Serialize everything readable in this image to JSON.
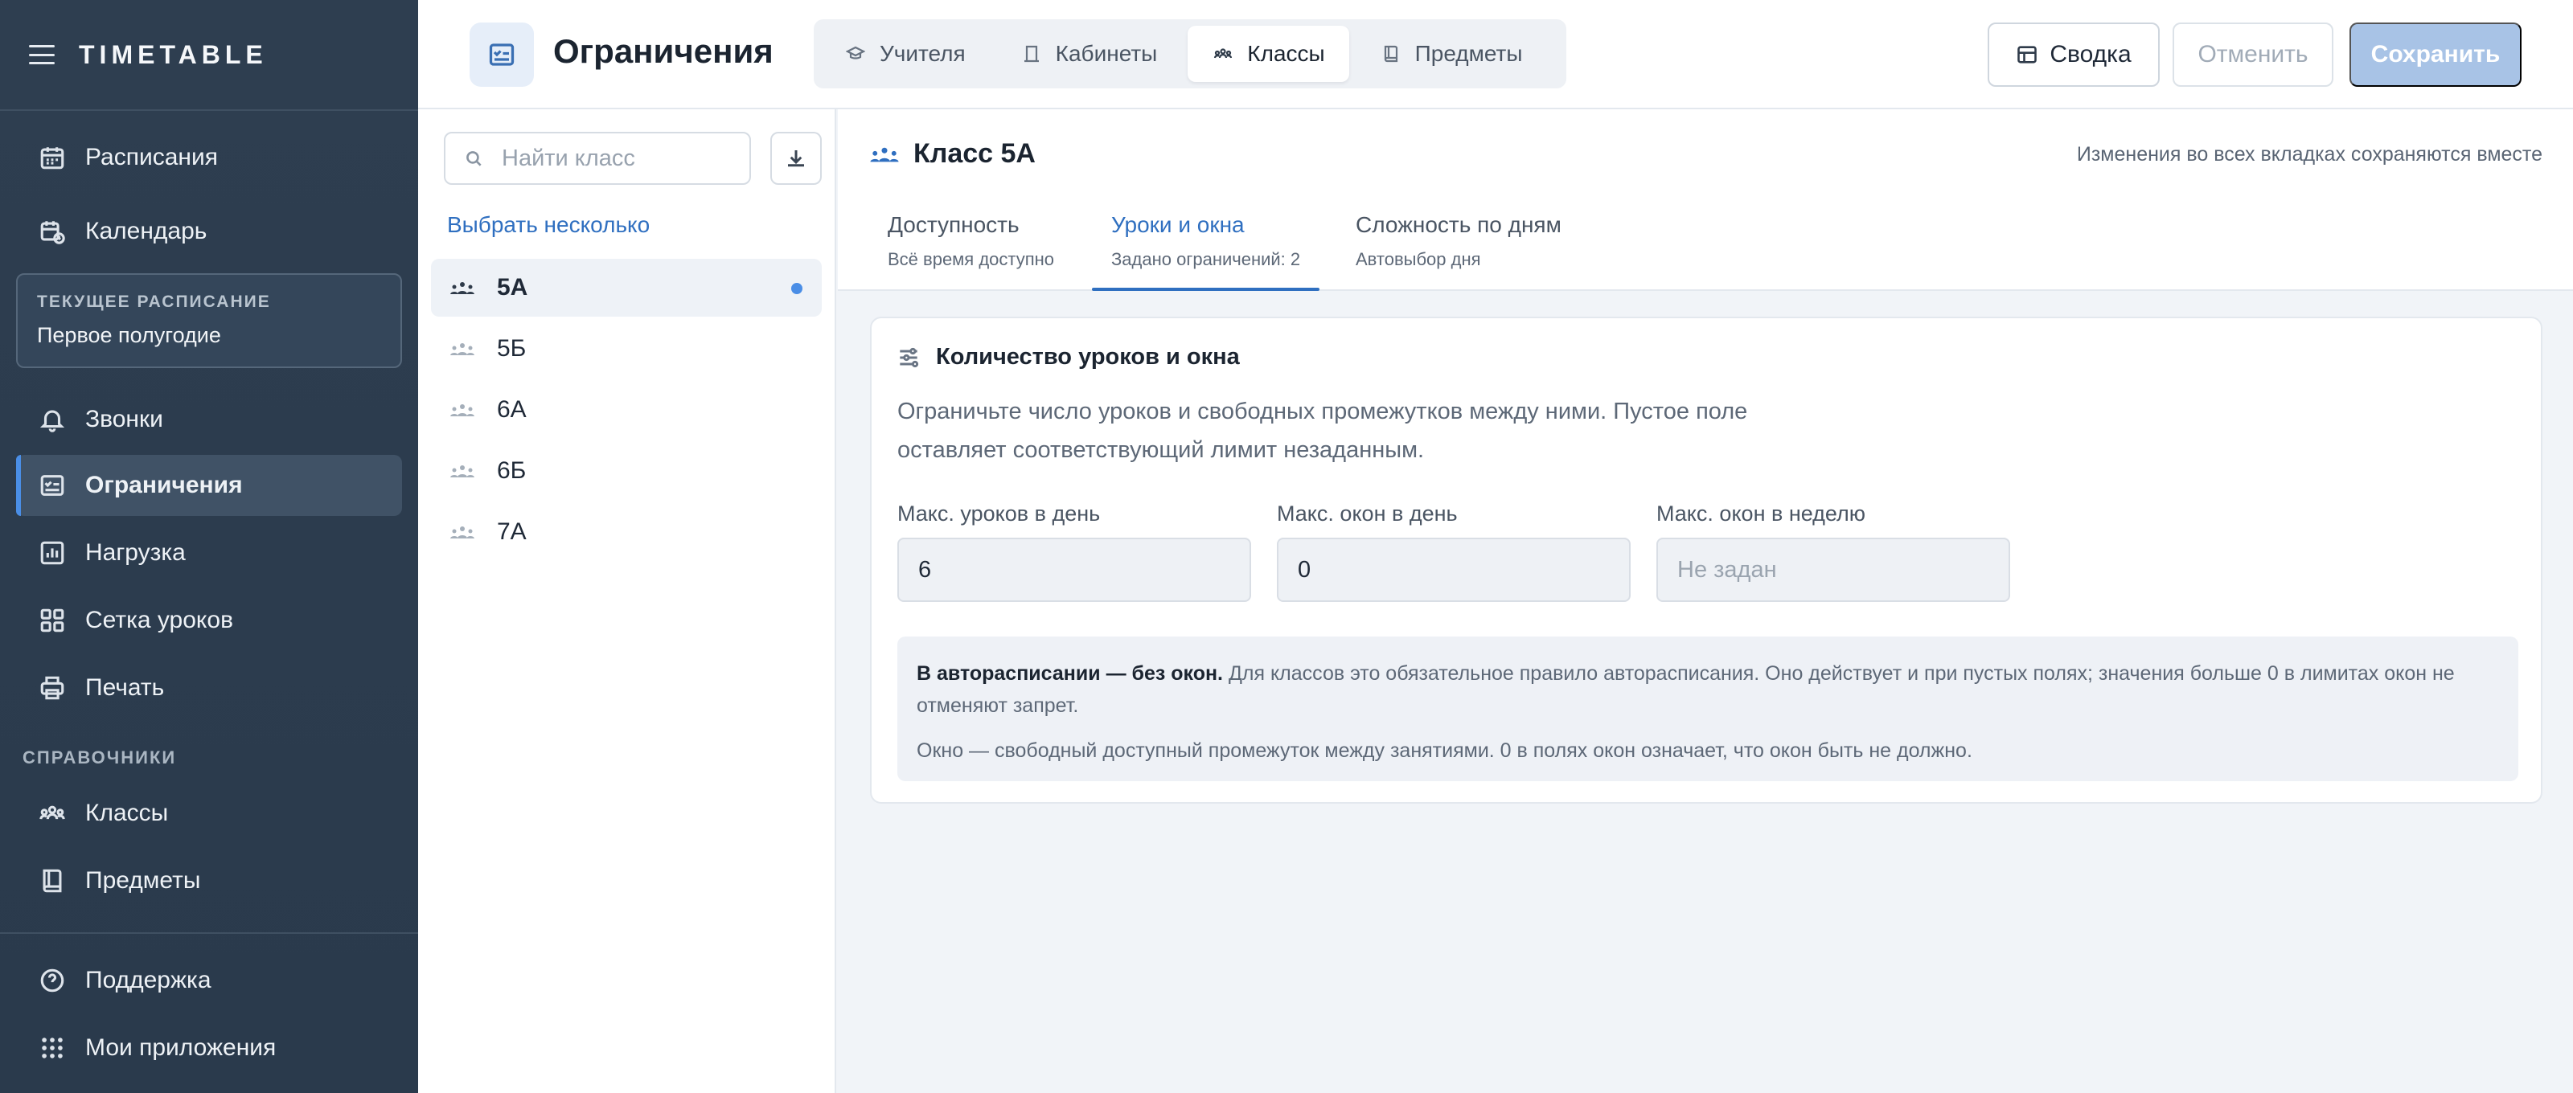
{
  "app": {
    "brand": "TIMETABLE"
  },
  "sidebar": {
    "items_top": [
      {
        "label": "Расписания",
        "icon": "calendar-icon"
      },
      {
        "label": "Календарь",
        "icon": "calendar-clock-icon"
      }
    ],
    "current": {
      "caption": "ТЕКУЩЕЕ РАСПИСАНИЕ",
      "value": "Первое полугодие"
    },
    "items_mid": [
      {
        "label": "Звонки",
        "icon": "bell-icon"
      },
      {
        "label": "Ограничения",
        "icon": "checklist-icon",
        "active": true
      },
      {
        "label": "Нагрузка",
        "icon": "bar-chart-icon"
      },
      {
        "label": "Сетка уроков",
        "icon": "grid-icon"
      },
      {
        "label": "Печать",
        "icon": "printer-icon"
      }
    ],
    "section_caption": "СПРАВОЧНИКИ",
    "items_ref": [
      {
        "label": "Классы",
        "icon": "group-icon"
      },
      {
        "label": "Предметы",
        "icon": "book-icon"
      }
    ],
    "items_bottom": [
      {
        "label": "Поддержка",
        "icon": "help-icon"
      },
      {
        "label": "Мои приложения",
        "icon": "apps-grid-icon"
      }
    ]
  },
  "header": {
    "title": "Ограничения",
    "tabs": [
      {
        "label": "Учителя",
        "icon": "teacher-icon"
      },
      {
        "label": "Кабинеты",
        "icon": "door-icon"
      },
      {
        "label": "Классы",
        "icon": "group-icon",
        "active": true
      },
      {
        "label": "Предметы",
        "icon": "book-icon"
      }
    ],
    "summary_label": "Сводка",
    "cancel_label": "Отменить",
    "save_label": "Сохранить"
  },
  "class_list": {
    "search_placeholder": "Найти класс",
    "select_many": "Выбрать несколько",
    "items": [
      {
        "label": "5А",
        "active": true,
        "modified": true
      },
      {
        "label": "5Б"
      },
      {
        "label": "6А"
      },
      {
        "label": "6Б"
      },
      {
        "label": "7А"
      }
    ]
  },
  "main": {
    "class_title": "Класс 5А",
    "note": "Изменения во всех вкладках сохраняются вместе",
    "subtabs": [
      {
        "title": "Доступность",
        "subtitle": "Всё время доступно"
      },
      {
        "title": "Уроки и окна",
        "subtitle": "Задано ограничений: 2",
        "active": true
      },
      {
        "title": "Сложность по дням",
        "subtitle": "Автовыбор дня"
      }
    ],
    "card": {
      "heading": "Количество уроков и окна",
      "description": "Ограничьте число уроков и свободных промежутков между ними. Пустое поле оставляет соответствующий лимит незаданным.",
      "fields": [
        {
          "label": "Макс. уроков в день",
          "value": "6"
        },
        {
          "label": "Макс. окон в день",
          "value": "0"
        },
        {
          "label": "Макс. окон в неделю",
          "value": "",
          "placeholder": "Не задан"
        }
      ],
      "info_bold": "В авторасписании — без окон.",
      "info_text": " Для классов это обязательное правило авторасписания. Оно действует и при пустых полях; значения больше 0 в лимитах окон не отменяют запрет.",
      "info_text2": "Окно — свободный доступный промежуток между занятиями. 0 в полях окон означает, что окон быть не должно."
    }
  },
  "colors": {
    "accent": "#2f6fc0",
    "sidebar_bg": "#2e3e50",
    "save_disabled": "#a8c3e6"
  }
}
